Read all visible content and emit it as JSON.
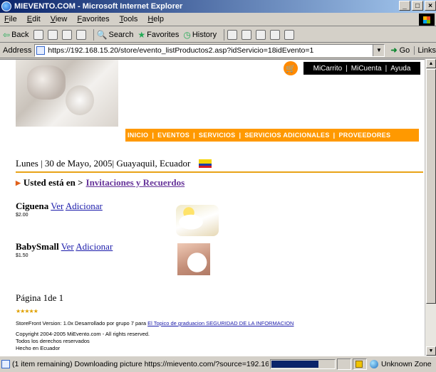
{
  "window": {
    "title": "MIEVENTO.COM - Microsoft Internet Explorer",
    "min": "_",
    "max": "□",
    "close": "×"
  },
  "menu": [
    "File",
    "Edit",
    "View",
    "Favorites",
    "Tools",
    "Help"
  ],
  "toolbar": {
    "back": "Back",
    "search": "Search",
    "favorites": "Favorites",
    "history": "History"
  },
  "address": {
    "label": "Address",
    "url": "https://192.168.15.20/store/evento_listProductos2.asp?idServicio=18idEvento=1",
    "go": "Go",
    "links": "Links"
  },
  "page": {
    "account": {
      "cart": "MiCarrito",
      "account": "MiCuenta",
      "help": "Ayuda",
      "sep": "|"
    },
    "nav": [
      "INICIO",
      "EVENTOS",
      "SERVICIOS",
      "SERVICIOS ADICIONALES",
      "PROVEEDORES"
    ],
    "nav_sep": "|",
    "dateline": "Lunes | 30 de Mayo, 2005| Guayaquil, Ecuador",
    "breadcrumb_label": "Usted está en >",
    "breadcrumb_link": "Invitaciones y Recuerdos",
    "products": [
      {
        "name": "Ciguena",
        "view": "Ver",
        "add": "Adicionar",
        "price": "$2.00"
      },
      {
        "name": "BabySmall",
        "view": "Ver",
        "add": "Adicionar",
        "price": "$1.50"
      }
    ],
    "pagination": "Página 1de 1",
    "stars": "★★★★★",
    "footer": {
      "version": "StoreFront Version: 1.0x Desarrollado por grupo 7 para",
      "version_link": "El Topico de graduacion SEGURIDAD DE LA INFORMACION",
      "copyright": "Copyright 2004-2005 MiEvento.com - All rights reserved.",
      "rights": "Todos los derechos reservados",
      "made": "Hecho en Ecuador"
    }
  },
  "status": {
    "text": "(1 item remaining) Downloading picture https://mievento.com/?source=192.16(",
    "progress": 0.75,
    "zone": "Unknown Zone"
  }
}
